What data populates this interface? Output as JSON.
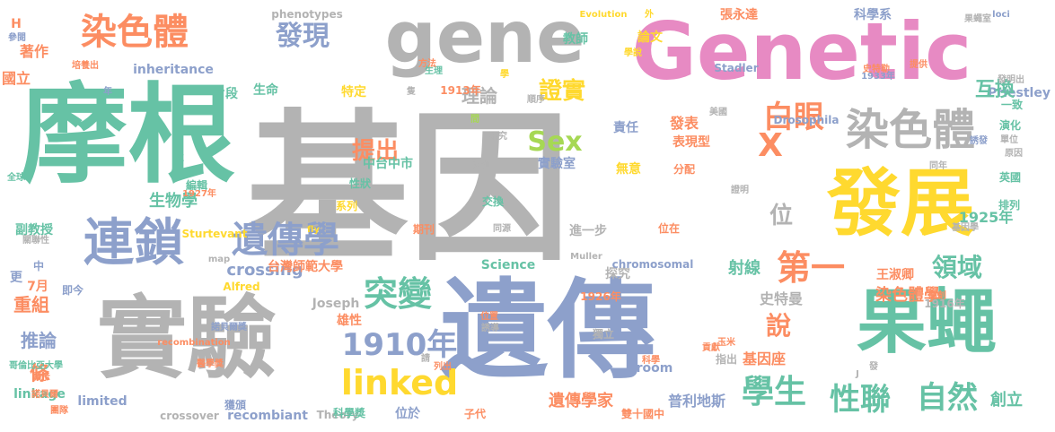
{
  "palette": {
    "teal": "#66c2a5",
    "orange": "#fc8d62",
    "blue": "#8da0cb",
    "pink": "#e78ac3",
    "green": "#a6d854",
    "yellow": "#ffd92f",
    "tan": "#e5c494",
    "gray": "#b3b3b3"
  },
  "words": [
    "基因",
    "摩根",
    "遺傳",
    "實驗",
    "Genetic",
    "gene",
    "發展",
    "果蠅",
    "連鎖",
    "染色體",
    "染色體",
    "遺傳學",
    "1910年",
    "linked",
    "突變",
    "第一",
    "白眼",
    "學生",
    "性聯",
    "自然",
    "發現",
    "領域",
    "Sex",
    "X",
    "位",
    "提出",
    "證實",
    "說",
    "crossing",
    "Priestley",
    "互換",
    "理論",
    "射線",
    "染色體學",
    "史特曼",
    "王淑卿",
    "生物學",
    "推論",
    "重組",
    "著作",
    "遺傳學家",
    "普利地斯",
    "創立",
    "條",
    "台灣師範大學",
    "中台中市",
    "雄性",
    "探究",
    "Science",
    "責任",
    "表現型",
    "發表",
    "實驗室",
    "無意",
    "分配",
    "Joseph",
    "inheritance",
    "phenotypes",
    "Drosophila",
    "科學系",
    "chromosomal",
    "crossover",
    "recombiant",
    "Theory",
    "linkage",
    "7月",
    "副教授",
    "國立",
    "H",
    "張永達",
    "教師",
    "論文",
    "特定",
    "生命",
    "片段",
    "編輯",
    "系列",
    "性狀",
    "位於",
    "雙十國中",
    "子代",
    "即今",
    "期刊",
    "1926年",
    "1913年",
    "1916年",
    "1925年",
    "同年",
    "英國",
    "排列",
    "交換",
    "位在",
    "同源",
    "進一步",
    "基因座",
    "獨立",
    "隻",
    "間",
    "Stadler",
    "Evolution",
    "Alfred",
    "Muller",
    "Sturtevant",
    "map",
    "loci",
    "room",
    "fly",
    "limited",
    "recombination",
    "中",
    "更",
    "全球",
    "次",
    "順序",
    "演化",
    "單位",
    "原因",
    "一致",
    "關聯性",
    "指出",
    "誘導",
    "列出",
    "證明",
    "學說",
    "生理",
    "方法",
    "外",
    "參閱",
    "培養出",
    "史特勒",
    "1933年",
    "發明出",
    "美國",
    "團隊",
    "提供",
    "哥倫比亞大學",
    "顯示",
    "研究",
    "獲頒",
    "科學獎",
    "位置",
    "科學",
    "玉米",
    "貢獻",
    "引領",
    "開創",
    "醫學獎",
    "誘發",
    "基因學",
    "果蠅室",
    "諾貝爾獎",
    "諾貝爾",
    "1927年",
    "請",
    "發",
    "學",
    "年",
    "J",
    "T",
    "L"
  ]
}
